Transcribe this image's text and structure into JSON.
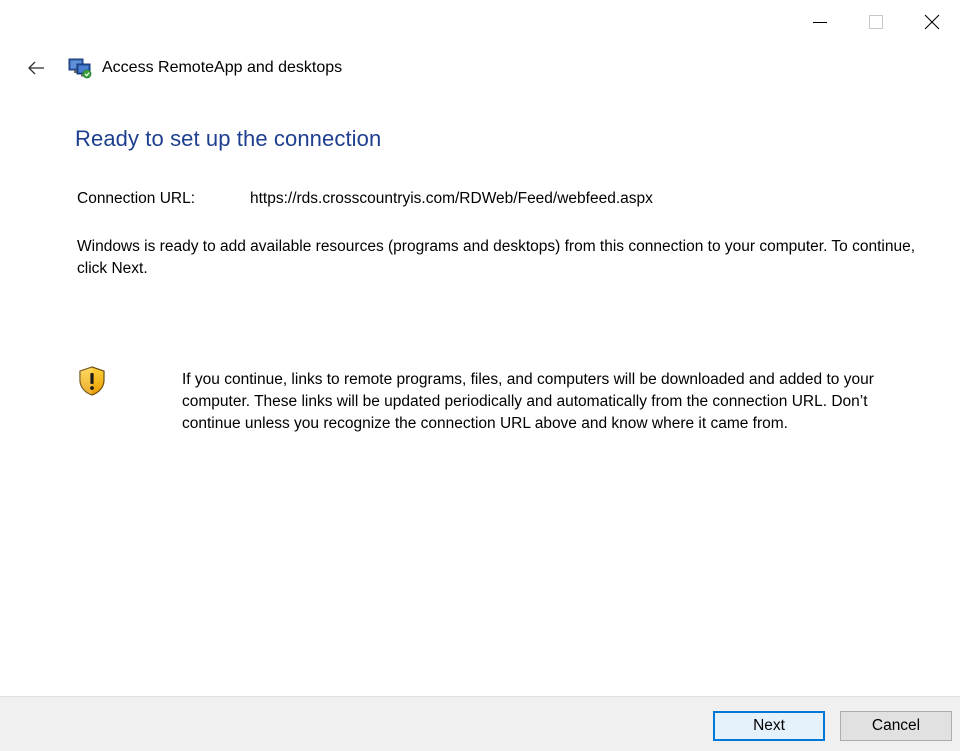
{
  "window": {
    "controls": {
      "minimize_icon": "minimize-icon",
      "maximize_icon": "maximize-icon",
      "close_icon": "close-icon"
    }
  },
  "header": {
    "back_icon": "back-arrow-icon",
    "app_icon": "remoteapp-icon",
    "title": "Access RemoteApp and desktops"
  },
  "main": {
    "title": "Ready to set up the connection",
    "connection_url_label": "Connection URL:",
    "connection_url_value": "https://rds.crosscountryis.com/RDWeb/Feed/webfeed.aspx",
    "description": "Windows is ready to add available resources (programs and desktops) from this connection to your computer. To continue, click Next.",
    "warning_icon": "shield-warning-icon",
    "warning_text": "If you continue, links to remote programs, files, and computers will be downloaded and added to your computer.  These links will be updated periodically and automatically from the connection URL. Don’t continue unless you recognize the connection URL above and know where it came from."
  },
  "footer": {
    "next_label": "Next",
    "cancel_label": "Cancel"
  },
  "colors": {
    "title_blue": "#1e3f8f",
    "focus_border": "#0078d7",
    "footer_bg": "#f0f0f0"
  }
}
